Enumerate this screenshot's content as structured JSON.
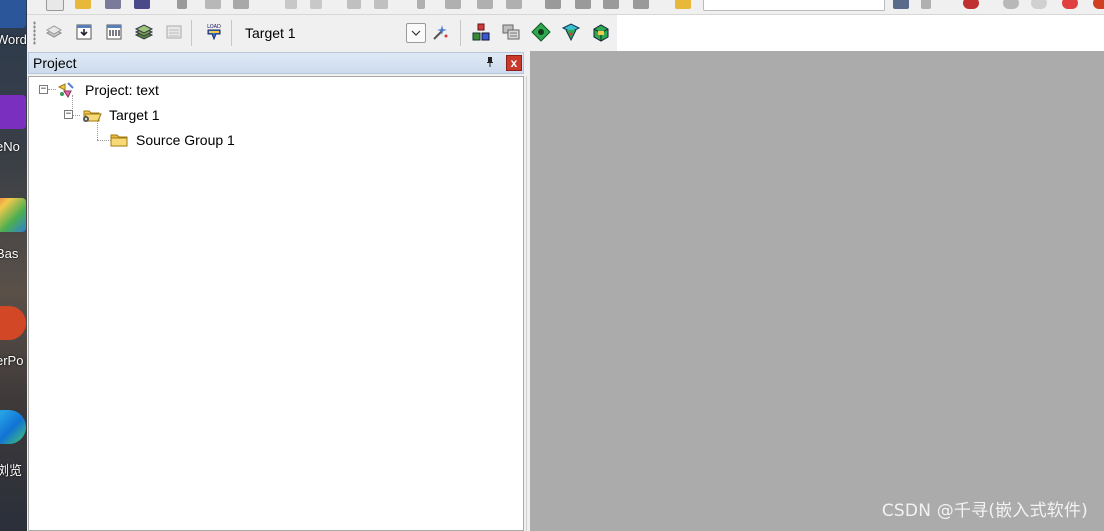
{
  "desktop": {
    "labels": [
      "Word",
      "eNo",
      "Bas",
      "erPo",
      "浏览"
    ]
  },
  "toolbar_build": {
    "target_selector": {
      "value": "Target 1"
    },
    "buttons": [
      "translate-icon",
      "build-icon",
      "rebuild-icon",
      "batch-build-icon",
      "stop-build-icon",
      "download-icon",
      "target-options-icon",
      "manage-components-icon",
      "file-extensions-icon",
      "select-packs-icon",
      "pack-installer-icon",
      "run-time-environment-icon"
    ],
    "download_label": "LOAD"
  },
  "project_pane": {
    "title": "Project",
    "pin_glyph": "⌸",
    "close_glyph": "x",
    "tree": {
      "root": {
        "label": "Project: text",
        "expander": "−"
      },
      "target": {
        "label": "Target 1",
        "expander": "−"
      },
      "group": {
        "label": "Source Group 1"
      }
    }
  },
  "watermark": "CSDN @千寻(嵌入式软件)",
  "colors": {
    "editor_background": "#ababab",
    "pane_header": "#cddbee",
    "close_button": "#c8392b",
    "folder": "#f2c94c"
  }
}
